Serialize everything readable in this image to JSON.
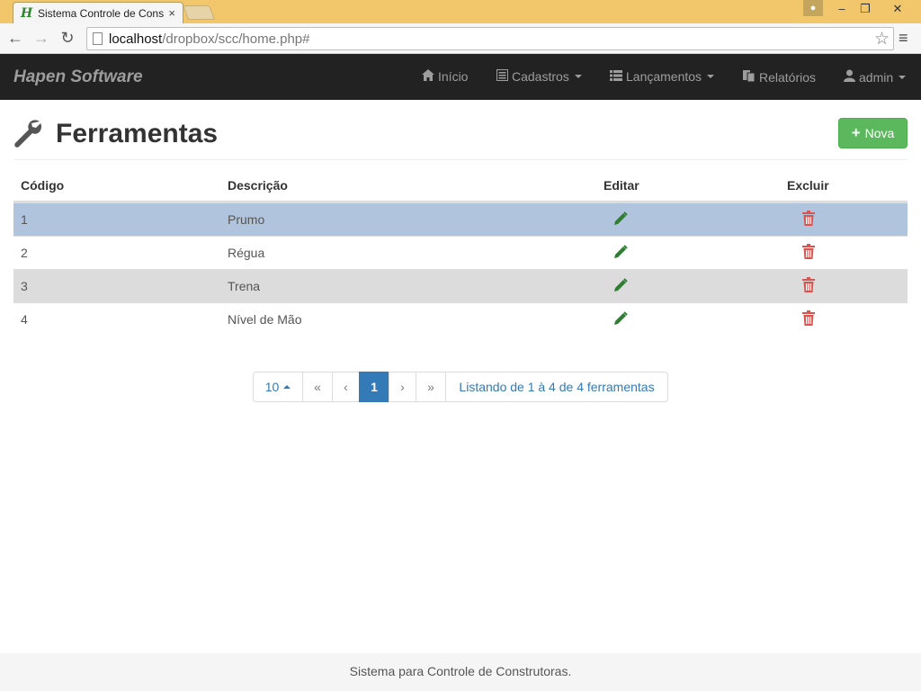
{
  "browser": {
    "tab_title": "Sistema Controle de Cons",
    "tab_close": "×",
    "url_host": "localhost",
    "url_path": "/dropbox/scc/home.php#",
    "back": "←",
    "forward": "→",
    "reload": "↻",
    "star": "☆",
    "menu": "≡",
    "minimize": "–",
    "restore": "❐",
    "close": "✕"
  },
  "navbar": {
    "brand": "Hapen Software",
    "items": [
      {
        "label": "Início",
        "icon": "home-icon",
        "dropdown": false
      },
      {
        "label": "Cadastros",
        "icon": "list-alt-icon",
        "dropdown": true
      },
      {
        "label": "Lançamentos",
        "icon": "th-list-icon",
        "dropdown": true
      },
      {
        "label": "Relatórios",
        "icon": "copy-icon",
        "dropdown": false
      },
      {
        "label": "admin",
        "icon": "user-icon",
        "dropdown": true
      }
    ]
  },
  "page": {
    "title": "Ferramentas",
    "title_icon": "wrench-icon",
    "new_button": "Nova"
  },
  "table": {
    "headers": {
      "codigo": "Código",
      "descricao": "Descrição",
      "editar": "Editar",
      "excluir": "Excluir"
    },
    "rows": [
      {
        "codigo": "1",
        "descricao": "Prumo"
      },
      {
        "codigo": "2",
        "descricao": "Régua"
      },
      {
        "codigo": "3",
        "descricao": "Trena"
      },
      {
        "codigo": "4",
        "descricao": "Nível de Mão"
      }
    ]
  },
  "pagination": {
    "page_size": "10",
    "first": "«",
    "prev": "‹",
    "current": "1",
    "next": "›",
    "last": "»",
    "summary": "Listando de 1 à 4 de 4 ferramentas"
  },
  "footer": {
    "text": "Sistema para Controle de Construtoras."
  },
  "colors": {
    "navbar": "#222222",
    "success": "#5cb85c",
    "primary": "#337ab7",
    "row_selected": "#b0c4de",
    "row_striped": "#dcdcdc",
    "edit_icon": "#2e7d32",
    "delete_icon": "#d9534f"
  }
}
